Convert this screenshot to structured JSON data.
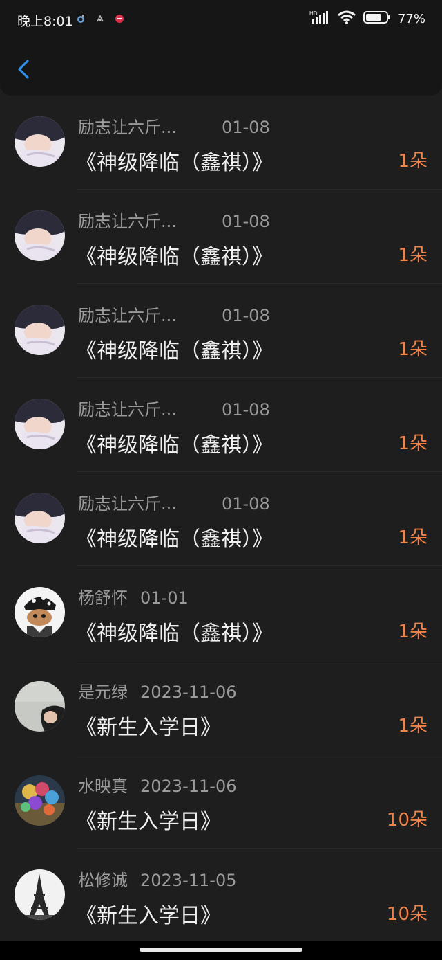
{
  "status_bar": {
    "time": "晚上8:01",
    "battery": "77%"
  },
  "colors": {
    "background": "#1e1e1e",
    "accent": "#f0834a",
    "back_icon": "#2f8fe8"
  },
  "rows": [
    {
      "name": "励志让六斤...",
      "date": "01-08",
      "book": "《神级降临（鑫祺）》",
      "count": "1朵",
      "avatar": "boy-sleeping-avatar"
    },
    {
      "name": "励志让六斤...",
      "date": "01-08",
      "book": "《神级降临（鑫祺）》",
      "count": "1朵",
      "avatar": "boy-sleeping-avatar"
    },
    {
      "name": "励志让六斤...",
      "date": "01-08",
      "book": "《神级降临（鑫祺）》",
      "count": "1朵",
      "avatar": "boy-sleeping-avatar"
    },
    {
      "name": "励志让六斤...",
      "date": "01-08",
      "book": "《神级降临（鑫祺）》",
      "count": "1朵",
      "avatar": "boy-sleeping-avatar"
    },
    {
      "name": "励志让六斤...",
      "date": "01-08",
      "book": "《神级降临（鑫祺）》",
      "count": "1朵",
      "avatar": "boy-sleeping-avatar"
    },
    {
      "name": "杨舒怀",
      "date": "01-01",
      "book": "《神级降临（鑫祺）》",
      "count": "1朵",
      "avatar": "cartoon-character-avatar"
    },
    {
      "name": "是元绿",
      "date": "2023-11-06",
      "book": "《新生入学日》",
      "count": "1朵",
      "avatar": "person-wall-avatar"
    },
    {
      "name": "水映真",
      "date": "2023-11-06",
      "book": "《新生入学日》",
      "count": "10朵",
      "avatar": "balloons-avatar"
    },
    {
      "name": "松修诚",
      "date": "2023-11-05",
      "book": "《新生入学日》",
      "count": "10朵",
      "avatar": "eiffel-tower-avatar"
    }
  ]
}
